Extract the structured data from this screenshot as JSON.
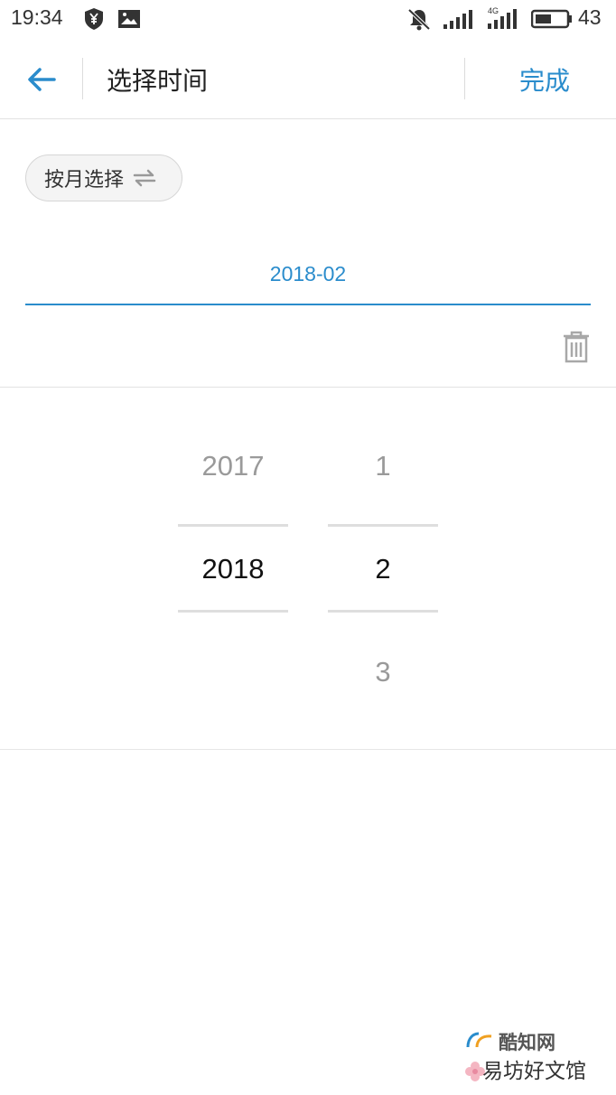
{
  "status_bar": {
    "time": "19:34",
    "battery_level": "43",
    "icons": [
      "shield-yen-icon",
      "image-icon",
      "muted-bell-icon",
      "signal-icon",
      "signal-4g-icon",
      "battery-icon"
    ]
  },
  "header": {
    "title": "选择时间",
    "done_label": "完成",
    "back_icon": "arrow-left-icon"
  },
  "mode": {
    "label": "按月选择",
    "icon": "swap-arrows-icon"
  },
  "date_field": {
    "value": "2018-02"
  },
  "picker": {
    "years": [
      "2017",
      "2018"
    ],
    "selected_year": "2018",
    "months": [
      "1",
      "2",
      "3"
    ],
    "selected_month": "2"
  },
  "watermark": {
    "line1": "酷知网",
    "line2": "易坊好文馆"
  },
  "colors": {
    "accent": "#2a8ccc",
    "text": "#222222",
    "muted": "#9a9a9a",
    "divider": "#e2e2e2"
  }
}
